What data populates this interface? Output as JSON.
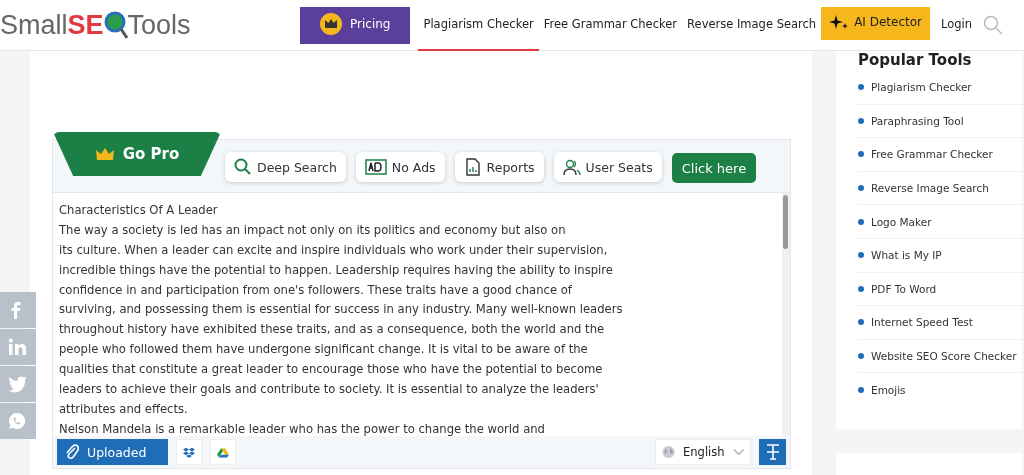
{
  "logo": {
    "part1": "Small",
    "part2": "SE",
    "part3": "Tools"
  },
  "nav": [
    {
      "kind": "pricing",
      "label": "Pricing",
      "selected": false
    },
    {
      "kind": "link",
      "label": "Plagiarism Checker",
      "selected": true
    },
    {
      "kind": "link",
      "label": "Free Grammar Checker",
      "selected": false
    },
    {
      "kind": "link",
      "label": "Reverse Image Search",
      "selected": false
    },
    {
      "kind": "ai",
      "label": "AI Detector",
      "selected": false
    },
    {
      "kind": "link",
      "label": "Login",
      "selected": false
    }
  ],
  "go_pro": {
    "title": "Go Pro",
    "features": [
      {
        "kind": "search",
        "label": "Deep Search"
      },
      {
        "kind": "ads",
        "label": "No Ads"
      },
      {
        "kind": "reports",
        "label": "Reports"
      },
      {
        "kind": "seats",
        "label": "User Seats"
      }
    ],
    "cta": "Click here"
  },
  "editor": {
    "lines": [
      "Characteristics Of A Leader",
      "The way a society is led has an impact not only on its politics and economy but also on",
      "its culture. When a leader can excite and inspire individuals who work under their supervision,",
      "incredible things have the potential to happen. Leadership requires having the ability to inspire",
      "confidence in and participation from one's followers. These traits have a good chance of",
      "surviving, and possessing them is essential for success in any industry. Many well-known leaders",
      "throughout history have exhibited these traits, and as a consequence, both the world and the",
      "people who followed them have undergone significant change. It is vital to be aware of the",
      "qualities that constitute a great leader to encourage those who have the potential to become",
      "leaders to achieve their goals and contribute to society. It is essential to analyze the leaders'",
      "attributes and effects.",
      "Nelson Mandela is a remarkable leader who has the power to change the world and"
    ]
  },
  "toolbar": {
    "upload": "Uploaded",
    "language": "English"
  },
  "social": [
    {
      "kind": "facebook"
    },
    {
      "kind": "linkedin"
    },
    {
      "kind": "twitter"
    },
    {
      "kind": "whatsapp"
    }
  ],
  "sidebar": {
    "title": "Popular Tools",
    "items": [
      "Plagiarism Checker",
      "Paraphrasing Tool",
      "Free Grammar Checker",
      "Reverse Image Search",
      "Logo Maker",
      "What is My IP",
      "PDF To Word",
      "Internet Speed Test",
      "Website SEO Score Checker",
      "Emojis"
    ]
  }
}
